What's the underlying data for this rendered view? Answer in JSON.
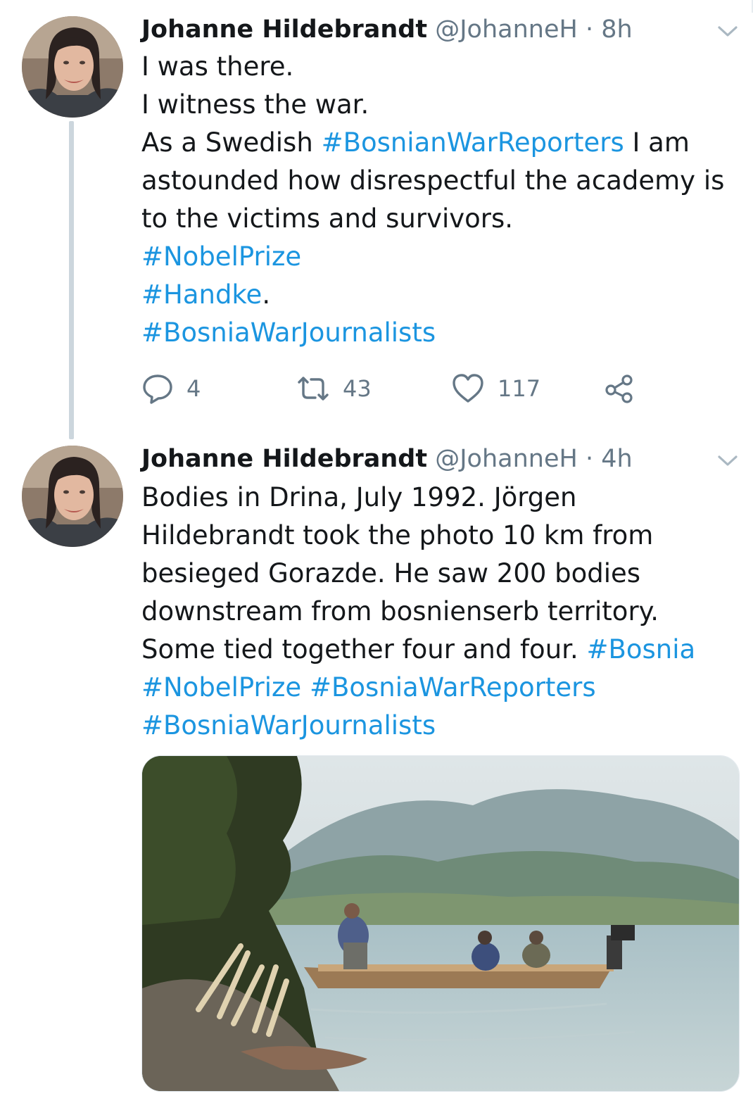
{
  "tweets": [
    {
      "author": {
        "name": "Johanne Hildebrandt",
        "handle": "@JohanneH",
        "separator": "·",
        "time": "8h"
      },
      "lines": [
        [
          {
            "t": "I was there."
          }
        ],
        [
          {
            "t": "I witness the war."
          }
        ],
        [
          {
            "t": "As a Swedish  "
          },
          {
            "t": "#BosnianWarReporters",
            "tag": true
          },
          {
            "t": " I am"
          }
        ],
        [
          {
            "t": "astounded how disrespectful the academy is"
          }
        ],
        [
          {
            "t": "to the victims and survivors."
          }
        ],
        [
          {
            "t": "#NobelPrize",
            "tag": true
          }
        ],
        [
          {
            "t": "#Handke",
            "tag": true
          },
          {
            "t": "."
          }
        ],
        [
          {
            "t": " #BosniaWarJournalists",
            "tag": true
          }
        ]
      ],
      "actions": {
        "replies": "4",
        "retweets": "43",
        "likes": "117"
      }
    },
    {
      "author": {
        "name": "Johanne Hildebrandt",
        "handle": "@JohanneH",
        "separator": "·",
        "time": "4h"
      },
      "lines": [
        [
          {
            "t": "Bodies in Drina, July 1992.    Jörgen"
          }
        ],
        [
          {
            "t": "Hildebrandt took the photo 10 km from"
          }
        ],
        [
          {
            "t": "besieged Gorazde. He saw 200 bodies"
          }
        ],
        [
          {
            "t": "downstream from bosnienserb territory."
          }
        ],
        [
          {
            "t": "Some tied together four and four.  "
          },
          {
            "t": "#Bosnia",
            "tag": true
          }
        ],
        [
          {
            "t": "#NobelPrize",
            "tag": true
          },
          {
            "t": " "
          },
          {
            "t": "#BosniaWarReporters",
            "tag": true
          }
        ],
        [
          {
            "t": "#BosniaWarJournalists",
            "tag": true
          }
        ]
      ],
      "media": {
        "kind": "photo",
        "subject": "river-boat-photo"
      }
    }
  ],
  "icons": {
    "reply": "reply-icon",
    "retweet": "retweet-icon",
    "like": "heart-icon",
    "share": "share-icon",
    "caret": "chevron-down-icon"
  },
  "colors": {
    "text": "#14171a",
    "secondary": "#657786",
    "link": "#1b95e0",
    "thread_line": "#ccd6dd"
  }
}
